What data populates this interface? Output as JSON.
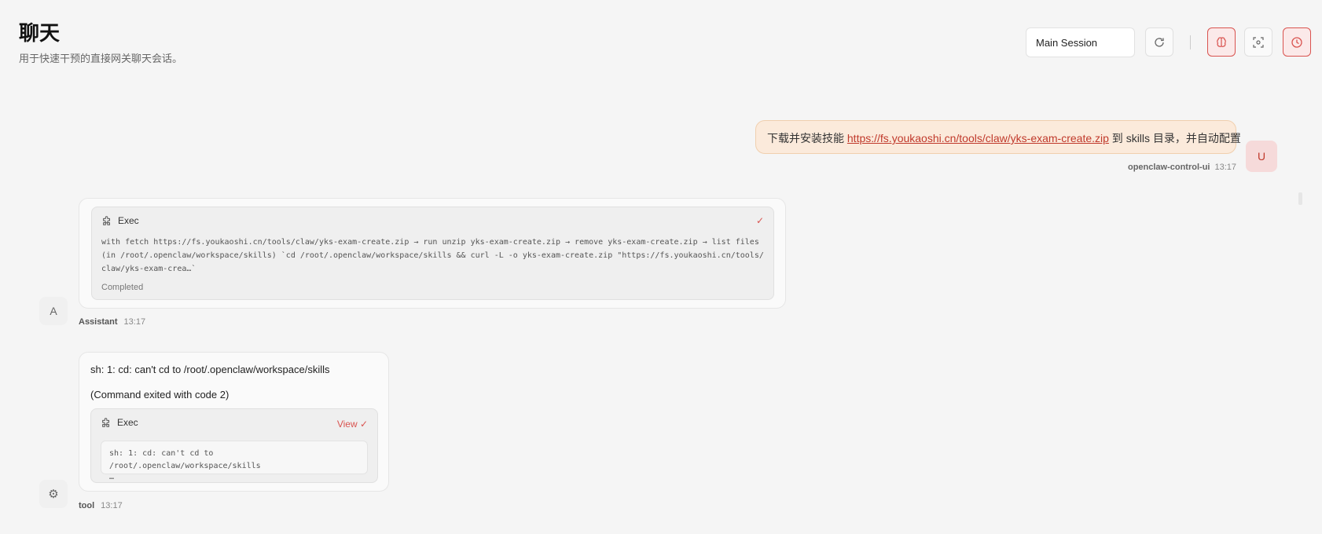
{
  "header": {
    "title": "聊天",
    "subtitle": "用于快速干预的直接网关聊天会话。",
    "session": "Main Session"
  },
  "toolbar": {
    "refresh_icon": "refresh-icon",
    "brain_icon": "brain-icon",
    "focus_icon": "focus-icon",
    "clock_icon": "clock-icon",
    "accent": "#d9534f"
  },
  "user_message": {
    "text_before": "下载并安装技能 ",
    "link": "https://fs.youkaoshi.cn/tools/claw/yks-exam-create.zip",
    "text_after": " 到 skills 目录，并自动配置",
    "avatar": "U",
    "sender": "openclaw-control-ui",
    "time": "13:17"
  },
  "assistant_message": {
    "tool_name": "Exec",
    "check": "✓",
    "command": "with fetch https://fs.youkaoshi.cn/tools/claw/yks-exam-create.zip → run unzip yks-exam-create.zip → remove yks-exam-create.zip → list files (in /root/.openclaw/workspace/skills) `cd /root/.openclaw/workspace/skills && curl -L -o yks-exam-create.zip \"https://fs.youkaoshi.cn/tools/claw/yks-exam-crea…`",
    "status": "Completed",
    "avatar": "A",
    "sender": "Assistant",
    "time": "13:17"
  },
  "tool_message": {
    "line1": "sh: 1: cd: can't cd to /root/.openclaw/workspace/skills",
    "line2": "(Command exited with code 2)",
    "tool_name": "Exec",
    "view_label": "View ✓",
    "output": "sh: 1: cd: can't cd to /root/.openclaw/workspace/skills",
    "output_ellipsis": "…",
    "avatar": "⚙",
    "sender": "tool",
    "time": "13:17"
  }
}
